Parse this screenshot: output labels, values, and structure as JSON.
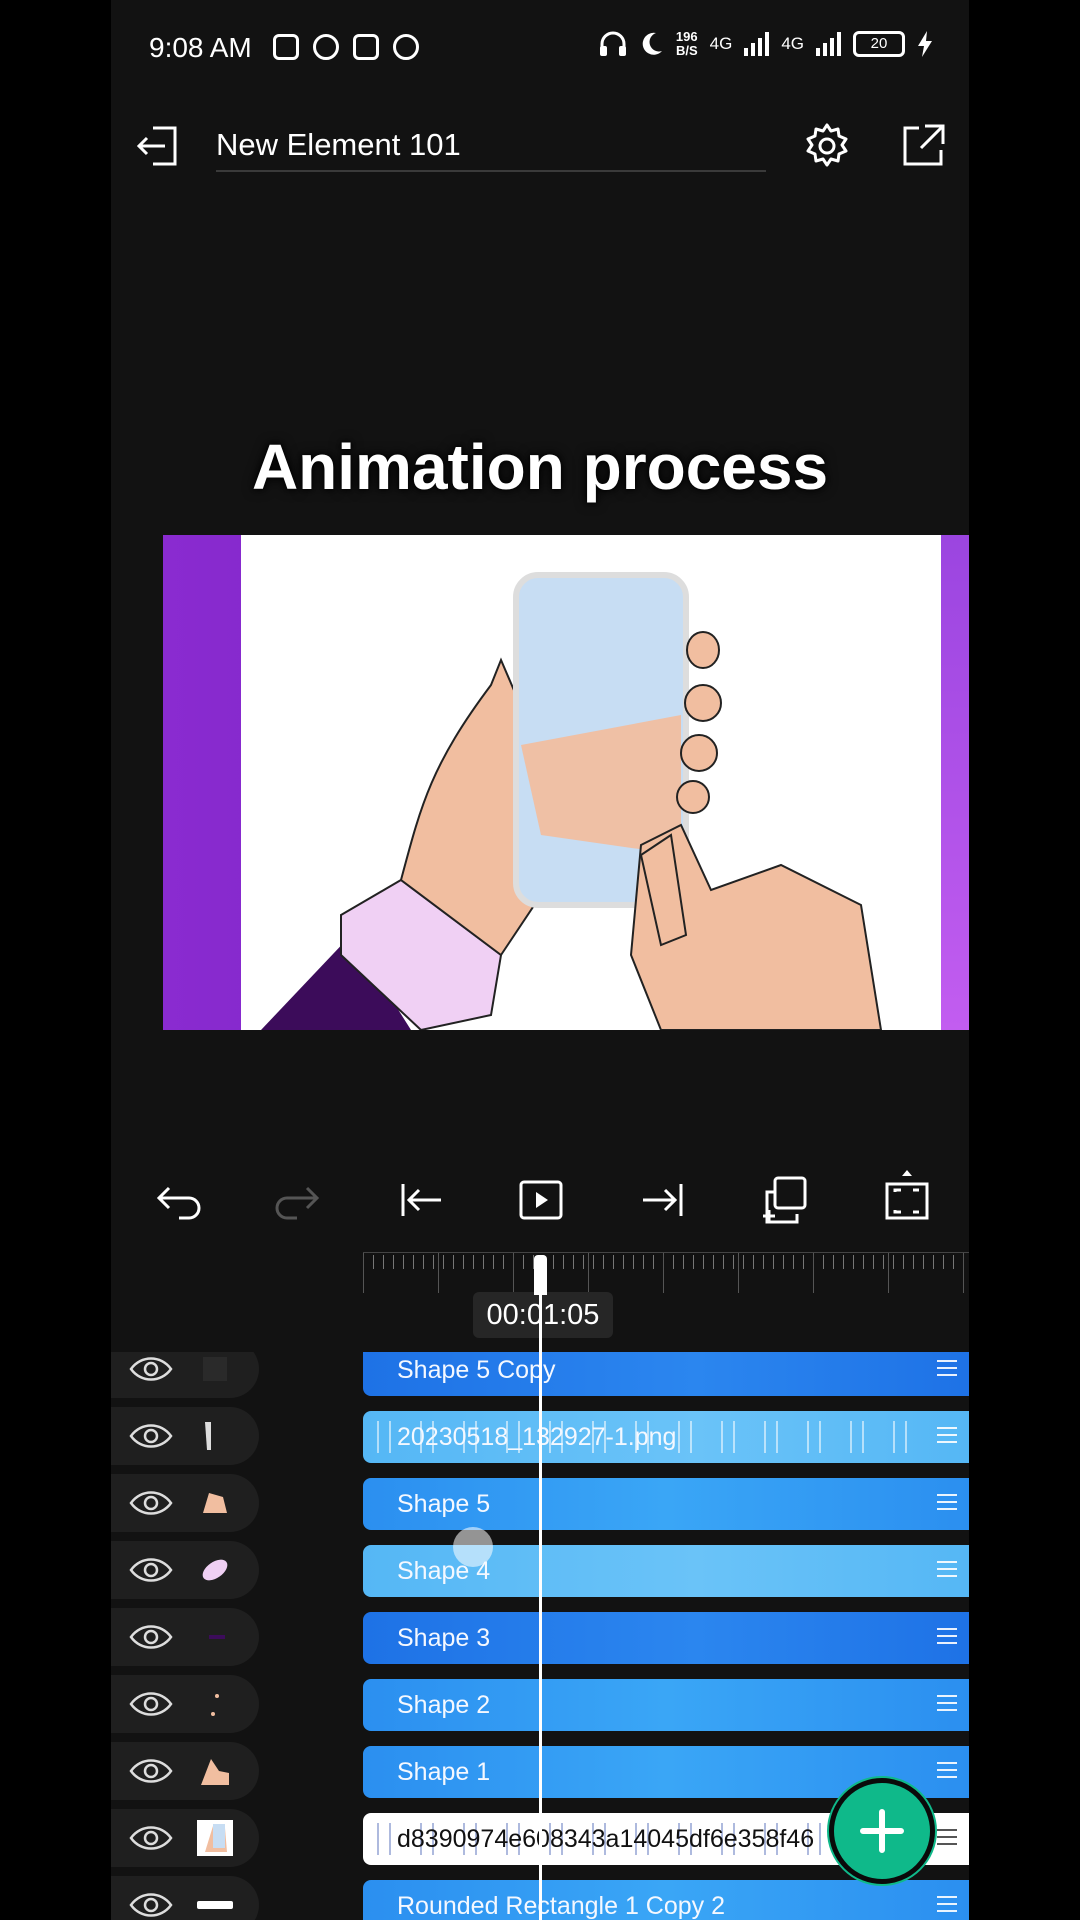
{
  "status_bar": {
    "time": "9:08 AM",
    "net_speed_value": "196",
    "net_speed_unit": "B/S",
    "network_1": "4G",
    "network_2": "4G",
    "battery": "20"
  },
  "app_bar": {
    "project_name": "New Element 101"
  },
  "canvas": {
    "heading": "Animation process"
  },
  "timeline": {
    "timecode": "00:01:05",
    "layers": [
      {
        "name": "Shape 5 Copy",
        "style": "dark"
      },
      {
        "name": "20230518_132927-1.png",
        "style": "light",
        "frames": true
      },
      {
        "name": "Shape 5",
        "style": "normal"
      },
      {
        "name": "Shape 4",
        "style": "light"
      },
      {
        "name": "Shape 3",
        "style": "dark"
      },
      {
        "name": "Shape 2",
        "style": "normal"
      },
      {
        "name": "Shape 1",
        "style": "normal"
      },
      {
        "name": "d8390974e608343a14045df6e358f46",
        "style": "white",
        "frames": true
      },
      {
        "name": "Rounded Rectangle 1 Copy 2",
        "style": "normal"
      }
    ]
  },
  "colors": {
    "accent": "#0fb98a",
    "track_blue": "#2b8ff0",
    "stage_purple": "#8a2bd0"
  }
}
